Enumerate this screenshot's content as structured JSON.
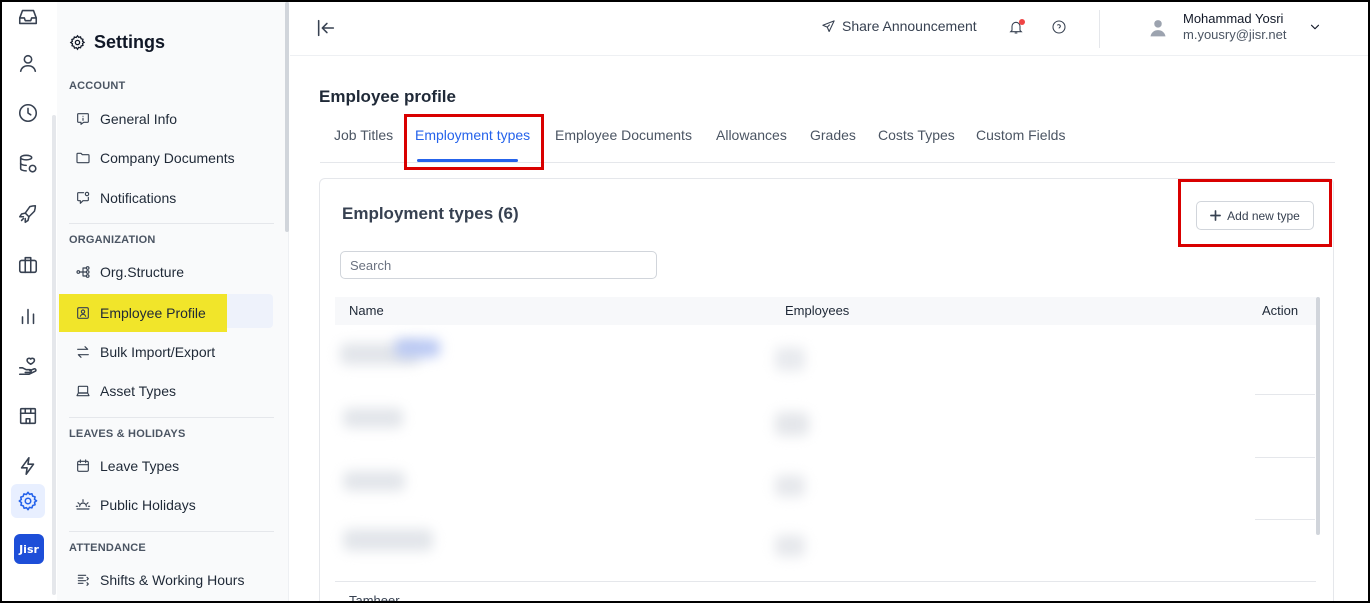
{
  "rail": {
    "items": [
      "inbox-icon",
      "user-icon",
      "clock-icon",
      "database-icon",
      "rocket-icon",
      "briefcase-icon",
      "chart-icon",
      "hand-heart-icon",
      "building-icon",
      "lightning-icon",
      "settings-icon"
    ],
    "logo": "Jisr"
  },
  "sidebar": {
    "title": "Settings",
    "sections": {
      "account": "ACCOUNT",
      "organization": "ORGANIZATION",
      "leaves": "LEAVES & HOLIDAYS",
      "attendance": "ATTENDANCE"
    },
    "items": {
      "general_info": "General Info",
      "company_documents": "Company Documents",
      "notifications": "Notifications",
      "org_structure": "Org.Structure",
      "employee_profile": "Employee Profile",
      "bulk_import_export": "Bulk Import/Export",
      "asset_types": "Asset Types",
      "leave_types": "Leave Types",
      "public_holidays": "Public Holidays",
      "shifts_working_hours": "Shifts & Working Hours"
    },
    "active_highlight_color": "#f1e52a"
  },
  "header": {
    "share": "Share Announcement",
    "user_name": "Mohammad Yosri",
    "user_email": "m.yousry@jisr.net"
  },
  "page": {
    "title": "Employee profile",
    "tabs": [
      "Job Titles",
      "Employment types",
      "Employee Documents",
      "Allowances",
      "Grades",
      "Costs Types",
      "Custom Fields"
    ],
    "active_tab": "Employment types"
  },
  "card": {
    "title": "Employment types (6)",
    "add_button": "Add new type",
    "search_placeholder": "Search",
    "columns": {
      "name": "Name",
      "employees": "Employees",
      "action": "Action"
    },
    "partial_row_name": "Tamheer"
  },
  "colors": {
    "accent": "#2563eb",
    "annotation": "#d90000"
  }
}
